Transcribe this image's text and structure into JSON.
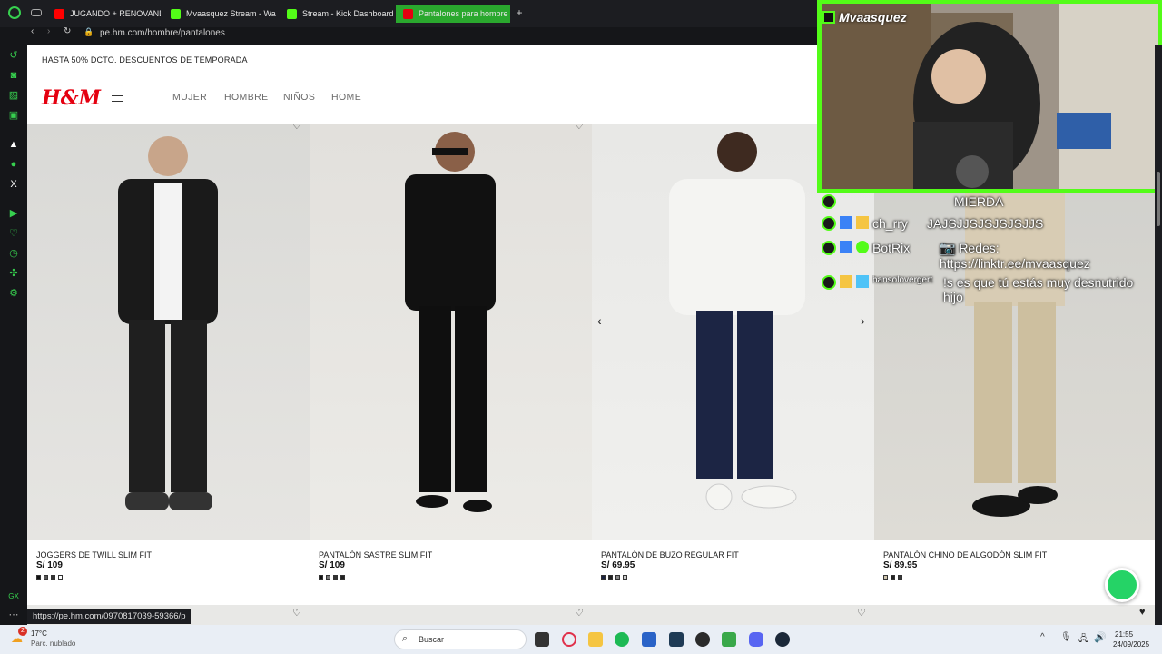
{
  "browser": {
    "tabs": [
      {
        "label": "JUGANDO + RENOVANDO",
        "icon": "youtube-icon"
      },
      {
        "label": "Mvaasquez Stream - Wa",
        "icon": "kick-icon"
      },
      {
        "label": "Stream - Kick Dashboard",
        "icon": "kick-icon"
      },
      {
        "label": "Pantalones para hombre",
        "icon": "hm-icon"
      }
    ],
    "url": "pe.hm.com/hombre/pantalones",
    "status_url": "https://pe.hm.com/0970817039-59366/p"
  },
  "sidebar": {
    "gx_label": "GX"
  },
  "store": {
    "promo": "HASTA 50% DCTO. DESCUENTOS DE TEMPORADA",
    "logo": "H&M",
    "nav": [
      "MUJER",
      "HOMBRE",
      "NIÑOS",
      "HOME"
    ],
    "products": [
      {
        "name": "JOGGERS DE TWILL SLIM FIT",
        "price": "S/ 109",
        "swatches": [
          "#111111",
          "#555555",
          "#333333",
          "#ffffff"
        ]
      },
      {
        "name": "PANTALÓN SASTRE SLIM FIT",
        "price": "S/ 109",
        "swatches": [
          "#111111",
          "#777777",
          "#333333",
          "#222222"
        ]
      },
      {
        "name": "PANTALÓN DE BUZO REGULAR FIT",
        "price": "S/ 69.95",
        "swatches": [
          "#1b2340",
          "#222222",
          "#888888",
          "#cccccc"
        ]
      },
      {
        "name": "PANTALÓN CHINO DE ALGODÓN SLIM FIT",
        "price": "S/ 89.95",
        "swatches": [
          "#cfc5ae",
          "#222222",
          "#3a3a3a"
        ]
      }
    ]
  },
  "stream": {
    "channel": "Mvaasquez",
    "chat": [
      {
        "user": "",
        "message": "MIERDA"
      },
      {
        "user": "ch_rry",
        "message": "JAJSJJSJSJSJSJJS"
      },
      {
        "user": "BotRix",
        "message": "📷 Redes: https://linktr.ee/mvaasquez"
      },
      {
        "user": "hansolovergert",
        "message": "!s es que tú estás muy desnutrido hijo"
      }
    ]
  },
  "taskbar": {
    "weather_temp": "17°C",
    "weather_desc": "Parc. nublado",
    "weather_badge": "2",
    "search_placeholder": "Buscar",
    "time": "21:55",
    "date": "24/09/2025"
  },
  "colors": {
    "accent": "#53fc18",
    "opera": "#37d04f",
    "hm_red": "#e50010"
  }
}
